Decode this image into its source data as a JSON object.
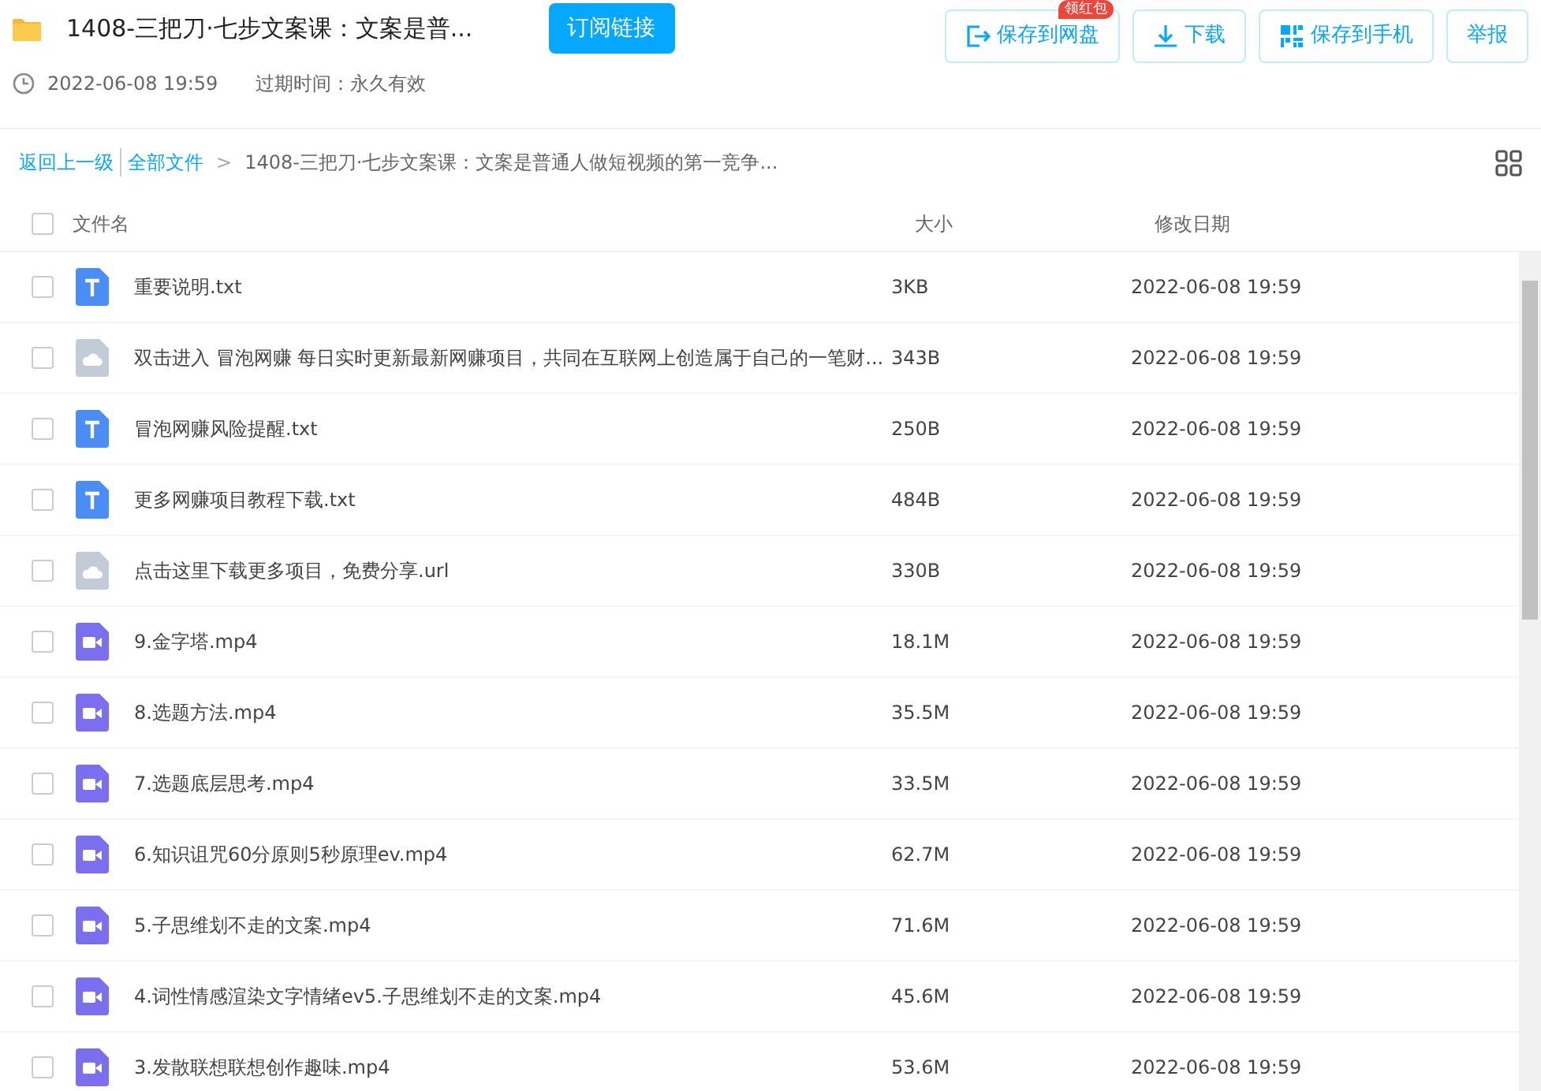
{
  "header": {
    "title": "1408-三把刀·七步文案课：文案是普...",
    "subscribe_button": "订阅链接",
    "actions": [
      {
        "label": "保存到网盘",
        "kind": "save",
        "badge": "领红包"
      },
      {
        "label": "下载",
        "kind": "download"
      },
      {
        "label": "保存到手机",
        "kind": "phone"
      },
      {
        "label": "举报",
        "kind": "plain"
      }
    ],
    "date": "2022-06-08 19:59",
    "expiry": "过期时间：永久有效"
  },
  "breadcrumb": {
    "back": "返回上一级",
    "root": "全部文件",
    "separator": ">",
    "current": "1408-三把刀·七步文案课：文案是普通人做短视频的第一竞争..."
  },
  "table": {
    "columns": [
      "文件名",
      "大小",
      "修改日期"
    ],
    "select_all_checked": false,
    "rows": [
      {
        "kind": "text",
        "name": "重要说明.txt",
        "size": "3KB",
        "date": "2022-06-08 19:59",
        "checked": false
      },
      {
        "kind": "link",
        "name": "双击进入 冒泡网赚 每日实时更新最新网赚项目，共同在互联网上创造属于自己的一笔财...",
        "size": "343B",
        "date": "2022-06-08 19:59",
        "checked": false
      },
      {
        "kind": "text",
        "name": "冒泡网赚风险提醒.txt",
        "size": "250B",
        "date": "2022-06-08 19:59",
        "checked": false
      },
      {
        "kind": "text",
        "name": "更多网赚项目教程下载.txt",
        "size": "484B",
        "date": "2022-06-08 19:59",
        "checked": false
      },
      {
        "kind": "link",
        "name": "点击这里下载更多项目，免费分享.url",
        "size": "330B",
        "date": "2022-06-08 19:59",
        "checked": false
      },
      {
        "kind": "video",
        "name": "9.金字塔.mp4",
        "size": "18.1M",
        "date": "2022-06-08 19:59",
        "checked": false
      },
      {
        "kind": "video",
        "name": "8.选题方法.mp4",
        "size": "35.5M",
        "date": "2022-06-08 19:59",
        "checked": false
      },
      {
        "kind": "video",
        "name": "7.选题底层思考.mp4",
        "size": "33.5M",
        "date": "2022-06-08 19:59",
        "checked": false
      },
      {
        "kind": "video",
        "name": "6.知识诅咒60分原则5秒原理ev.mp4",
        "size": "62.7M",
        "date": "2022-06-08 19:59",
        "checked": false
      },
      {
        "kind": "video",
        "name": "5.子思维划不走的文案.mp4",
        "size": "71.6M",
        "date": "2022-06-08 19:59",
        "checked": false
      },
      {
        "kind": "video",
        "name": "4.词性情感渲染文字情绪ev5.子思维划不走的文案.mp4",
        "size": "45.6M",
        "date": "2022-06-08 19:59",
        "checked": false
      },
      {
        "kind": "video",
        "name": "3.发散联想联想创作趣味.mp4",
        "size": "53.6M",
        "date": "2022-06-08 19:59",
        "checked": false
      }
    ]
  }
}
